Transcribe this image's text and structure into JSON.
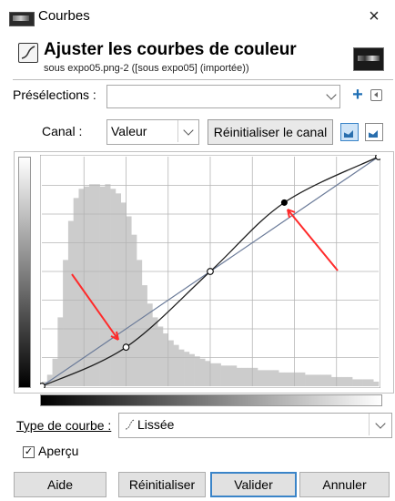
{
  "window": {
    "title": "Courbes",
    "close_symbol": "×"
  },
  "header": {
    "title": "Ajuster les courbes de couleur",
    "subtitle": "sous expo05.png-2 ([sous expo05] (importée))"
  },
  "presets": {
    "label": "Présélections :",
    "value": ""
  },
  "channel": {
    "label": "Canal :",
    "value": "Valeur",
    "reset_label": "Réinitialiser le canal",
    "mode": "linear"
  },
  "curve": {
    "grid_divisions": 8,
    "curve_color": "#1e1e1e",
    "identity_color": "#6b7b99",
    "histogram_color": "#cccccc",
    "arrow_color": "#ff2a2a",
    "control_points": [
      {
        "x": 0.0,
        "y": 0.0,
        "selected": false
      },
      {
        "x": 0.25,
        "y": 0.17,
        "selected": false
      },
      {
        "x": 0.5,
        "y": 0.5,
        "selected": false
      },
      {
        "x": 0.72,
        "y": 0.8,
        "selected": true
      },
      {
        "x": 1.0,
        "y": 1.0,
        "selected": false
      }
    ],
    "histogram": [
      0.02,
      0.05,
      0.12,
      0.3,
      0.55,
      0.72,
      0.82,
      0.86,
      0.87,
      0.88,
      0.88,
      0.87,
      0.88,
      0.86,
      0.84,
      0.8,
      0.74,
      0.66,
      0.55,
      0.44,
      0.36,
      0.3,
      0.26,
      0.23,
      0.2,
      0.18,
      0.16,
      0.15,
      0.14,
      0.13,
      0.12,
      0.11,
      0.1,
      0.1,
      0.09,
      0.09,
      0.09,
      0.08,
      0.08,
      0.08,
      0.08,
      0.07,
      0.07,
      0.07,
      0.07,
      0.06,
      0.06,
      0.06,
      0.06,
      0.06,
      0.05,
      0.05,
      0.05,
      0.05,
      0.05,
      0.04,
      0.04,
      0.04,
      0.04,
      0.03,
      0.03,
      0.03,
      0.03,
      0.02
    ]
  },
  "curve_type": {
    "label": "Type de courbe :",
    "value": "Lissée"
  },
  "preview": {
    "label": "Aperçu",
    "checked": true
  },
  "buttons": {
    "help": "Aide",
    "reset": "Réinitialiser",
    "ok": "Valider",
    "cancel": "Annuler"
  }
}
